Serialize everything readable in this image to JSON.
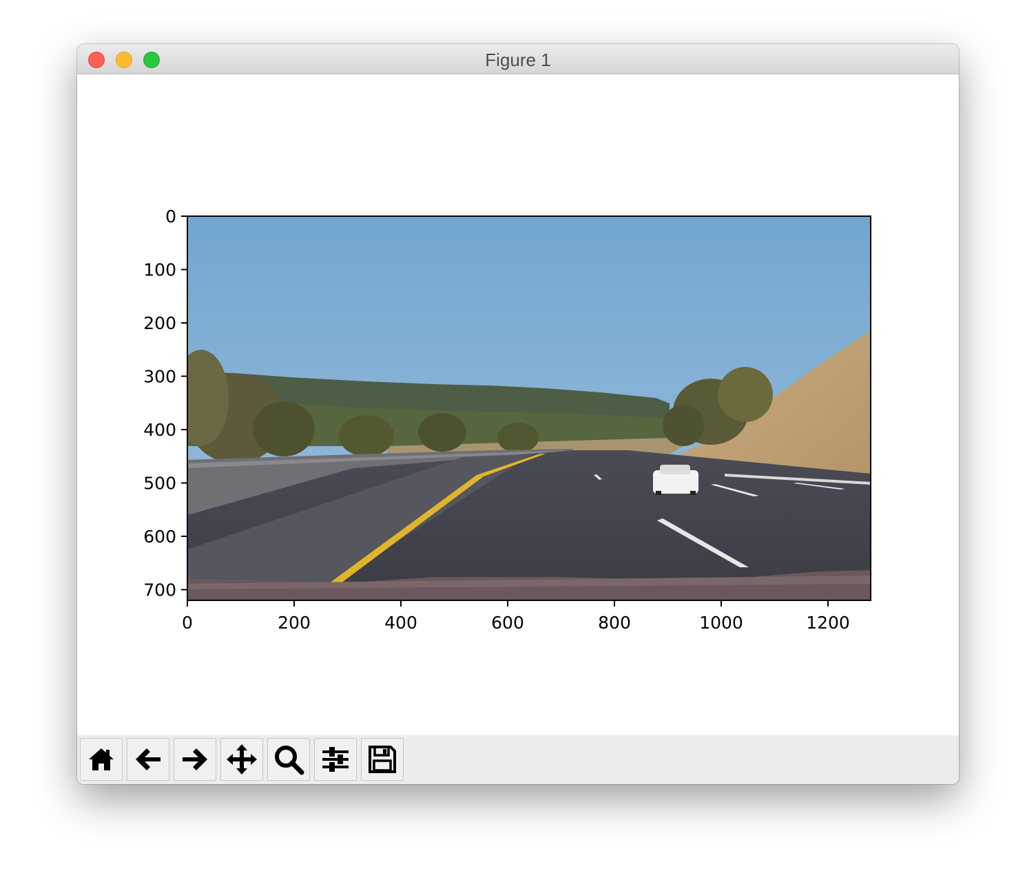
{
  "window": {
    "title": "Figure 1"
  },
  "figure": {
    "image_description": "dashcam highway road photo",
    "x_ticks": [
      "0",
      "200",
      "400",
      "600",
      "800",
      "1000",
      "1200"
    ],
    "y_ticks": [
      "0",
      "100",
      "200",
      "300",
      "400",
      "500",
      "600",
      "700"
    ]
  },
  "toolbar": {
    "tools": [
      {
        "name": "home-button",
        "icon": "home-icon"
      },
      {
        "name": "back-button",
        "icon": "arrow-left-icon"
      },
      {
        "name": "forward-button",
        "icon": "arrow-right-icon"
      },
      {
        "name": "pan-button",
        "icon": "move-icon"
      },
      {
        "name": "zoom-button",
        "icon": "magnifier-icon"
      },
      {
        "name": "configure-subplots-button",
        "icon": "sliders-icon"
      },
      {
        "name": "save-button",
        "icon": "floppy-disk-icon"
      }
    ]
  }
}
